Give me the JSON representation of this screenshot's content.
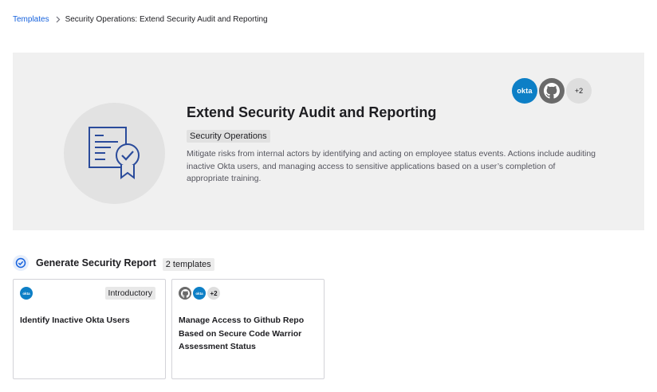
{
  "breadcrumb": {
    "root": "Templates",
    "current": "Security Operations: Extend Security Audit and Reporting"
  },
  "hero": {
    "title": "Extend Security Audit and Reporting",
    "tag": "Security Operations",
    "description": "Mitigate risks from internal actors by identifying and acting on employee status events. Actions include auditing inactive Okta users, and managing access to sensitive applications based on a user’s completion of appropriate training.",
    "apps": {
      "okta_label": "okta",
      "more_label": "+2"
    }
  },
  "section": {
    "title": "Generate Security Report",
    "count": "2 templates"
  },
  "cards": [
    {
      "title": "Identify Inactive Okta Users",
      "level": "Introductory",
      "okta_label": "okta"
    },
    {
      "title": "Manage Access to Github Repo Based on Secure Code Warrior Assessment Status",
      "okta_label": "okta",
      "more_label": "+2"
    }
  ],
  "colors": {
    "link": "#1662dd",
    "okta": "#0d7fc6",
    "github": "#6a6a6a",
    "hero_bg": "#f0f0f0",
    "illustration_stroke": "#2a4b9b"
  },
  "icons": [
    "chevron-right-icon",
    "certificate-icon",
    "okta-logo-icon",
    "github-icon",
    "check-circle-icon"
  ]
}
